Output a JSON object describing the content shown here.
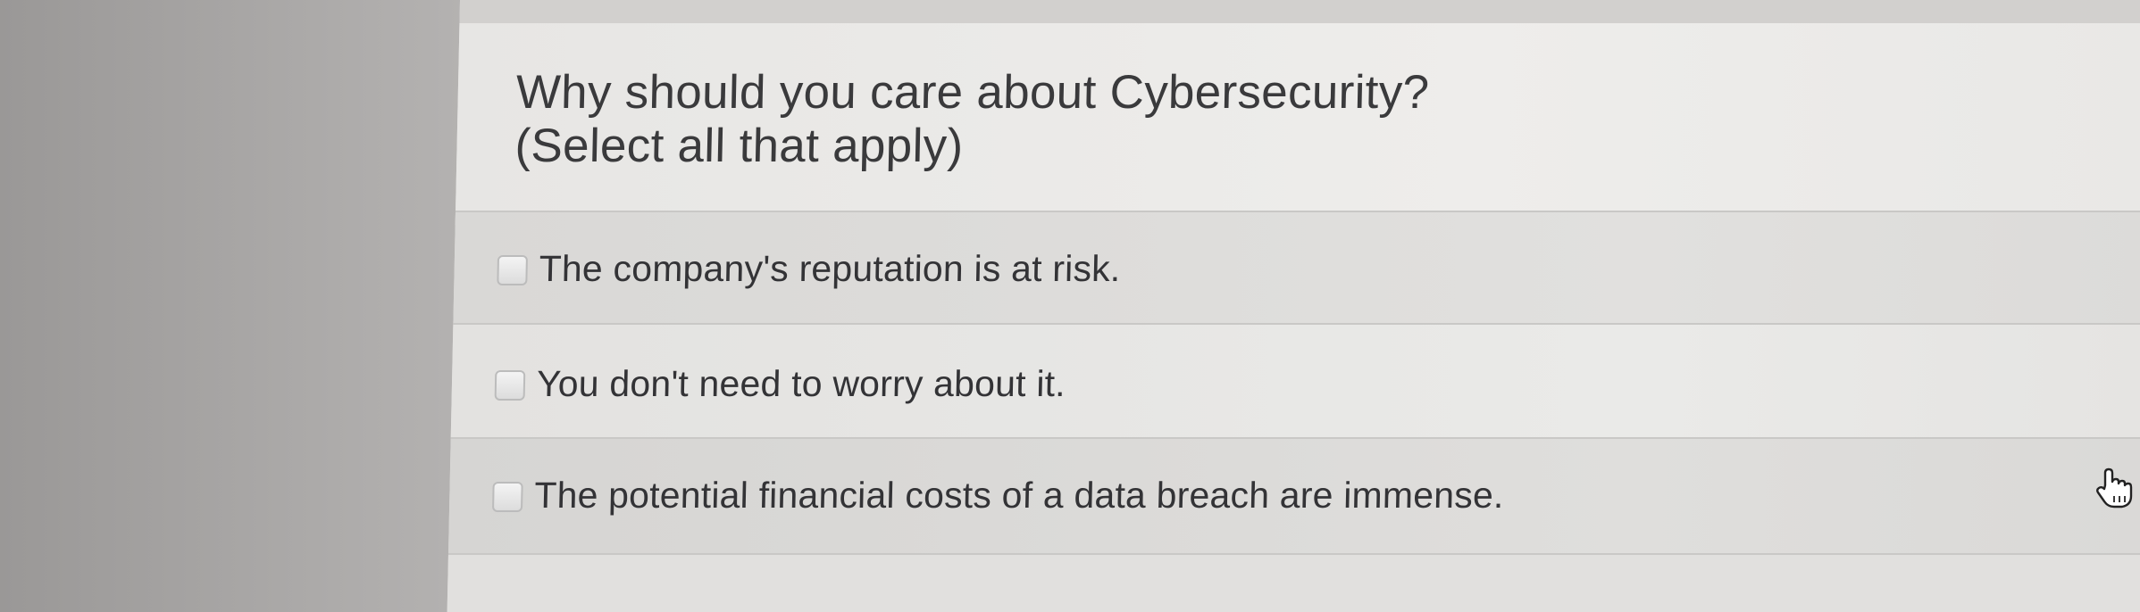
{
  "question": {
    "line1": "Why should you care about Cybersecurity?",
    "line2": "(Select all that apply)"
  },
  "options": [
    {
      "label": "The company's reputation is at risk.",
      "checked": false
    },
    {
      "label": "You don't need to worry about it.",
      "checked": false
    },
    {
      "label": "The potential financial costs of a data breach are immense.",
      "checked": false
    }
  ],
  "cursor": {
    "icon": "hand-pointer-icon"
  }
}
